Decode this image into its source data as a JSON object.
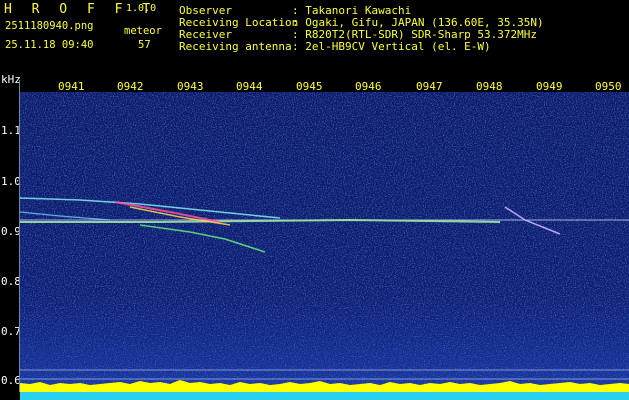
{
  "header": {
    "app_name": "H R O F F T",
    "version": "1.0.0",
    "filename": "2511180940.png",
    "type_label": "meteor",
    "datetime": "25.11.18 09:40",
    "count": "57"
  },
  "info": {
    "observer_label": "Observer",
    "observer_value": ": Takanori Kawachi",
    "location_label": "Receiving Location",
    "location_value": ": Ogaki, Gifu, JAPAN (136.60E, 35.35N)",
    "receiver_label": "Receiver",
    "receiver_value": ": R820T2(RTL-SDR) SDR-Sharp 53.372MHz",
    "antenna_label": "Receiving antenna",
    "antenna_value": ": 2el-HB9CV Vertical (el. E-W)"
  },
  "axes": {
    "y_unit": "kHz",
    "x_ticks": [
      "0941",
      "0942",
      "0943",
      "0944",
      "0945",
      "0946",
      "0947",
      "0948",
      "0949",
      "0950"
    ],
    "y_ticks": [
      "1.1",
      "1.0",
      "0.9",
      "0.8",
      "0.7",
      "0.6"
    ]
  },
  "colors": {
    "text_yellow": "#ffff3a",
    "text_cyan": "#35e0ff",
    "background": "#000000",
    "spectrum_bg": "#0b1c70",
    "noise_bar": "#ffff00"
  }
}
